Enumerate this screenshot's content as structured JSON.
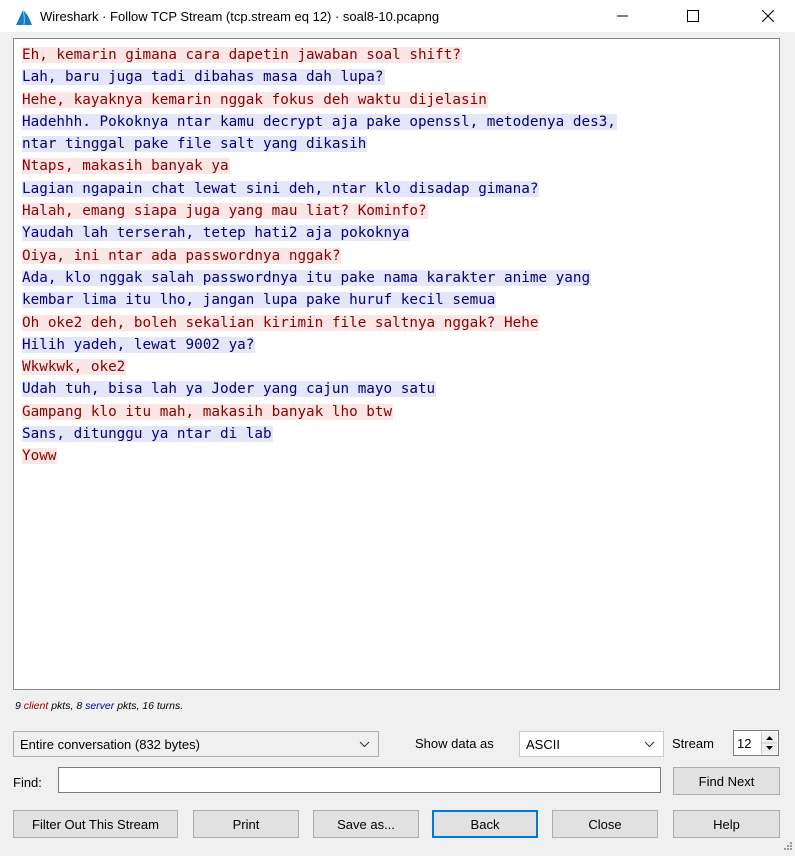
{
  "window": {
    "title": "Wireshark · Follow TCP Stream (tcp.stream eq 12) · soal8-10.pcapng"
  },
  "stream_lines": [
    {
      "side": "client",
      "text": "Eh, kemarin gimana cara dapetin jawaban soal shift?"
    },
    {
      "side": "server",
      "text": "Lah, baru juga tadi dibahas masa dah lupa?"
    },
    {
      "side": "client",
      "text": "Hehe, kayaknya kemarin nggak fokus deh waktu dijelasin"
    },
    {
      "side": "server",
      "text": "Hadehhh. Pokoknya ntar kamu decrypt aja pake openssl, metodenya des3,"
    },
    {
      "side": "server",
      "text": "ntar tinggal pake file salt yang dikasih"
    },
    {
      "side": "client",
      "text": "Ntaps, makasih banyak ya"
    },
    {
      "side": "server",
      "text": "Lagian ngapain chat lewat sini deh, ntar klo disadap gimana?"
    },
    {
      "side": "client",
      "text": "Halah, emang siapa juga yang mau liat? Kominfo?"
    },
    {
      "side": "server",
      "text": "Yaudah lah terserah, tetep hati2 aja pokoknya"
    },
    {
      "side": "client",
      "text": "Oiya, ini ntar ada passwordnya nggak?"
    },
    {
      "side": "server",
      "text": "Ada, klo nggak salah passwordnya itu pake nama karakter anime yang"
    },
    {
      "side": "server",
      "text": "kembar lima itu lho, jangan lupa pake huruf kecil semua"
    },
    {
      "side": "client",
      "text": "Oh oke2 deh, boleh sekalian kirimin file saltnya nggak? Hehe"
    },
    {
      "side": "server",
      "text": "Hilih yadeh, lewat 9002 ya?"
    },
    {
      "side": "client",
      "text": "Wkwkwk, oke2"
    },
    {
      "side": "server",
      "text": "Udah tuh, bisa lah ya Joder yang cajun mayo satu"
    },
    {
      "side": "client",
      "text": "Gampang klo itu mah, makasih banyak lho btw"
    },
    {
      "side": "server",
      "text": "Sans, ditunggu ya ntar di lab"
    },
    {
      "side": "client",
      "text": "Yoww"
    }
  ],
  "stats": {
    "client_count": "9",
    "client_word": "client",
    "pkts1": "pkts,",
    "server_count": "8",
    "server_word": "server",
    "pkts2": "pkts, 16 turns."
  },
  "controls": {
    "conversation_select": "Entire conversation (832 bytes)",
    "show_data_label": "Show data as",
    "show_data_value": "ASCII",
    "stream_label": "Stream",
    "stream_value": "12",
    "find_label": "Find:",
    "find_value": "",
    "find_next_label": "Find Next"
  },
  "buttons": {
    "filter_out": "Filter Out This Stream",
    "print": "Print",
    "save_as": "Save as...",
    "back": "Back",
    "close": "Close",
    "help": "Help"
  },
  "colors": {
    "client_text": "#8b0000",
    "client_bg": "#fbe6e6",
    "server_text": "#000080",
    "server_bg": "#e6e6fb",
    "focus_accent": "#0078d7"
  },
  "icons": {
    "app": "wireshark-fin-icon",
    "minimize": "minimize-icon",
    "maximize": "maximize-icon",
    "close": "close-icon"
  }
}
